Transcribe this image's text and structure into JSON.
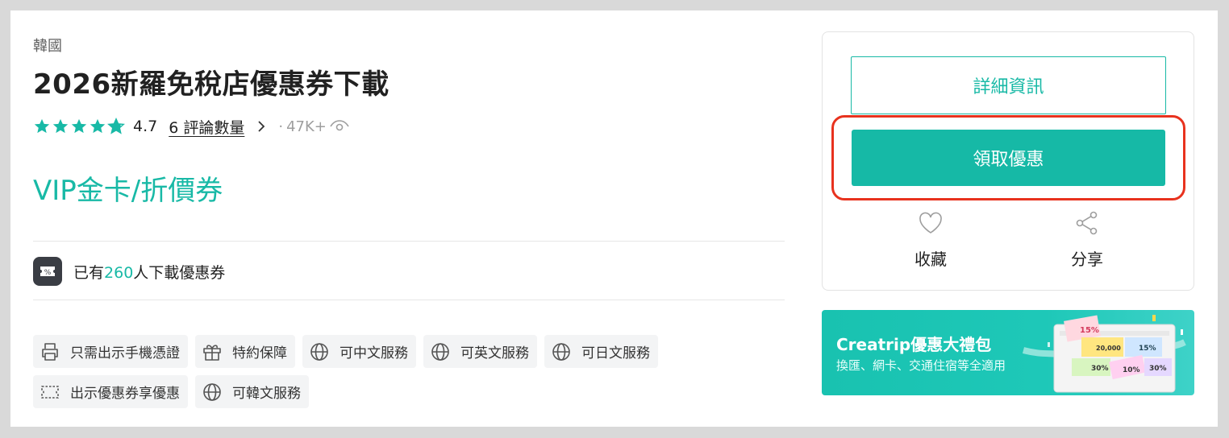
{
  "breadcrumb": {
    "country": "韓國"
  },
  "title": "2026新羅免稅店優惠券下載",
  "rating": {
    "score": "4.7",
    "stars": 4.5,
    "reviews": "6 評論數量",
    "separator": "·",
    "views": "47K+"
  },
  "product_name": "VIP金卡/折價券",
  "download": {
    "prefix": "已有",
    "count": "260",
    "suffix": "人下載優惠券"
  },
  "tags": [
    {
      "icon": "printer-icon",
      "label": "只需出示手機憑證"
    },
    {
      "icon": "gift-icon",
      "label": "特約保障"
    },
    {
      "icon": "globe-icon",
      "label": "可中文服務"
    },
    {
      "icon": "globe-icon",
      "label": "可英文服務"
    },
    {
      "icon": "globe-icon",
      "label": "可日文服務"
    },
    {
      "icon": "ticket-icon",
      "label": "出示優惠券享優惠"
    },
    {
      "icon": "globe-icon",
      "label": "可韓文服務"
    }
  ],
  "sidebar": {
    "detail_button": "詳細資訊",
    "claim_button": "領取優惠",
    "favorite_label": "收藏",
    "share_label": "分享"
  },
  "promo": {
    "title": "Creatrip優惠大禮包",
    "subtitle": "換匯、網卡、交通住宿等全適用",
    "coupons": [
      "15%",
      "20,000",
      "15%",
      "30%",
      "10%",
      "30%"
    ]
  },
  "colors": {
    "accent": "#18b9a6",
    "highlight": "#e8321e",
    "text": "#212121"
  }
}
